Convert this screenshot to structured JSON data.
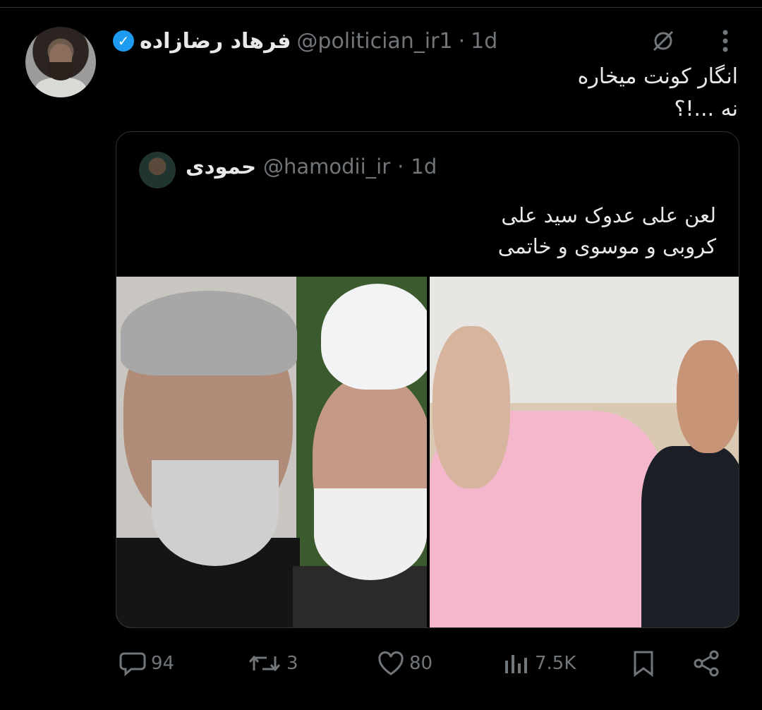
{
  "tweet": {
    "display_name": "فرهاد رضازاده",
    "handle": "@politician_ir1",
    "separator": "·",
    "time": "1d",
    "text": "انگار کونت میخاره\nنه ...!؟"
  },
  "quoted_tweet": {
    "display_name": "حمودی",
    "handle": "@hamodii_ir",
    "separator": "·",
    "time": "1d",
    "text": "لعن علی عدوک سید علی\nکروبی و موسوی و خاتمی"
  },
  "actions": {
    "replies": "94",
    "reposts": "3",
    "likes": "80",
    "views": "7.5K"
  },
  "icons": {
    "verified": "verified-badge-icon",
    "grok": "grok-icon",
    "more": "more-icon",
    "reply": "reply-icon",
    "repost": "repost-icon",
    "like": "like-icon",
    "views": "views-icon",
    "bookmark": "bookmark-icon",
    "share": "share-icon"
  },
  "colors": {
    "background": "#000000",
    "text": "#e7e9ea",
    "muted": "#71767b",
    "verified": "#1d9bf0"
  }
}
